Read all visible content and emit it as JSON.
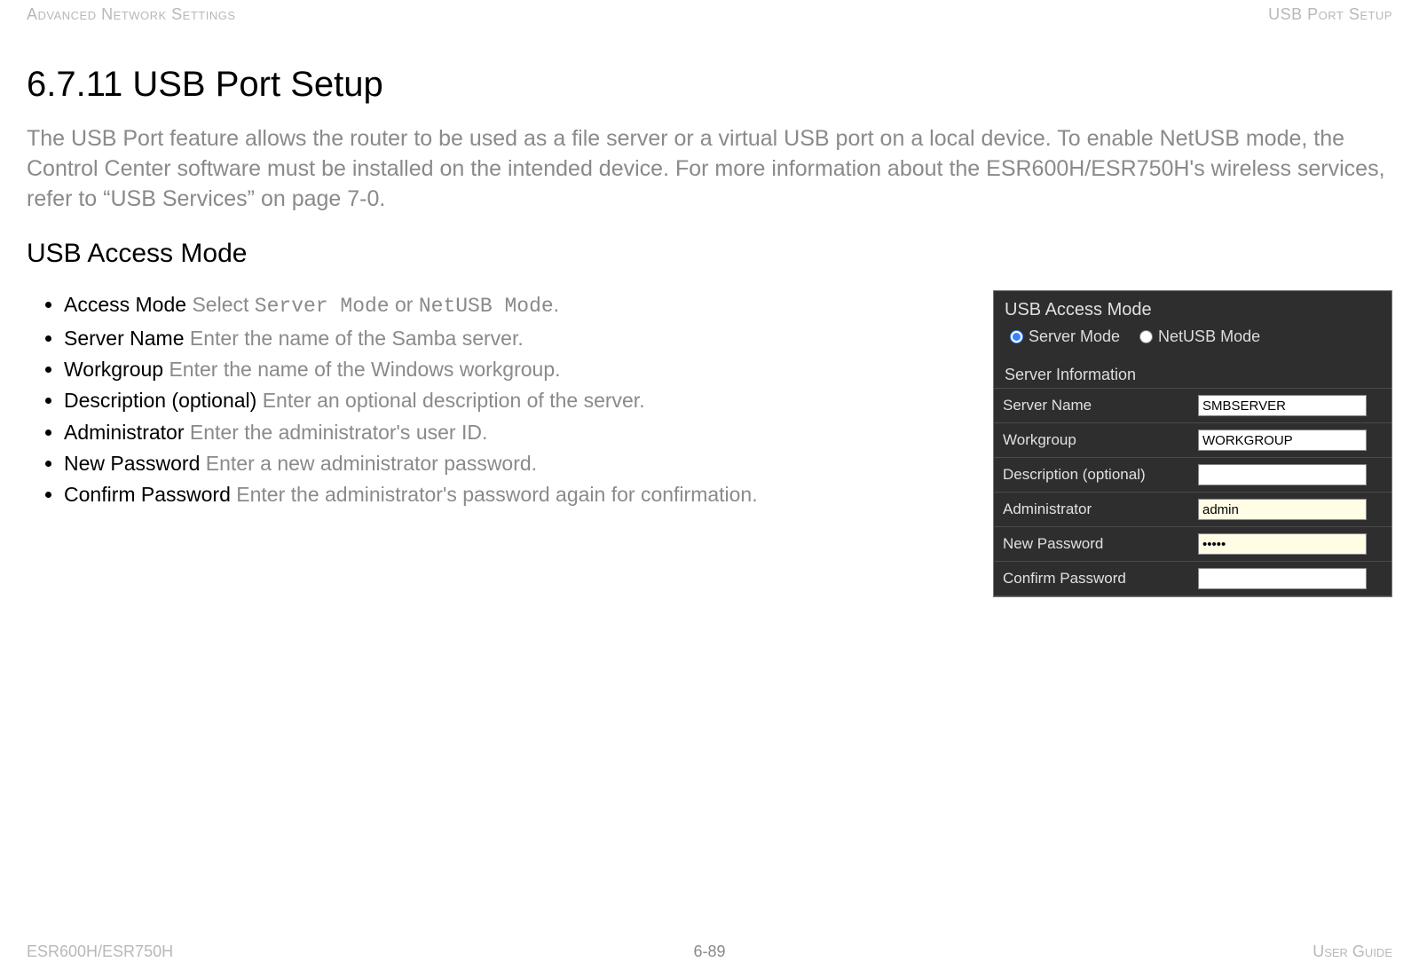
{
  "header": {
    "left": "Advanced Network Settings",
    "right": "USB Port Setup"
  },
  "title": "6.7.11 USB Port Setup",
  "intro": "The USB Port feature allows the router to be used as a file server or a virtual USB port on a local device. To enable NetUSB mode, the Control Center software must be installed on the intended device. For more information about the ESR600H/ESR750H's wireless services, refer to “USB Services” on page 7-0.",
  "subheading": "USB Access Mode",
  "bullets": [
    {
      "term": "Access Mode",
      "prefix": "  Select ",
      "mono1": "Server Mode",
      "mid": " or ",
      "mono2": "NetUSB Mode",
      "suffix": "."
    },
    {
      "term": "Server Name",
      "body": "  Enter the name of the Samba server."
    },
    {
      "term": "Workgroup",
      "body": "  Enter the name of the Windows workgroup."
    },
    {
      "term": "Description (optional)",
      "body": "  Enter an optional description of the server."
    },
    {
      "term": "Administrator",
      "body": "  Enter the administrator's user ID."
    },
    {
      "term": "New Password",
      "body": "  Enter a new administrator password."
    },
    {
      "term": "Confirm Password",
      "body": "  Enter the administrator's password again for confirmation."
    }
  ],
  "panel": {
    "title": "USB Access Mode",
    "radios": {
      "server": "Server Mode",
      "netusb": "NetUSB Mode",
      "selected": "server"
    },
    "section": "Server Information",
    "fields": {
      "server_name": {
        "label": "Server Name",
        "value": "SMBSERVER"
      },
      "workgroup": {
        "label": "Workgroup",
        "value": "WORKGROUP"
      },
      "description": {
        "label": "Description (optional)",
        "value": ""
      },
      "administrator": {
        "label": "Administrator",
        "value": "admin"
      },
      "new_password": {
        "label": "New Password",
        "value": "•••••"
      },
      "confirm_password": {
        "label": "Confirm Password",
        "value": ""
      }
    }
  },
  "footer": {
    "left": "ESR600H/ESR750H",
    "center": "6-89",
    "right": "User Guide"
  }
}
